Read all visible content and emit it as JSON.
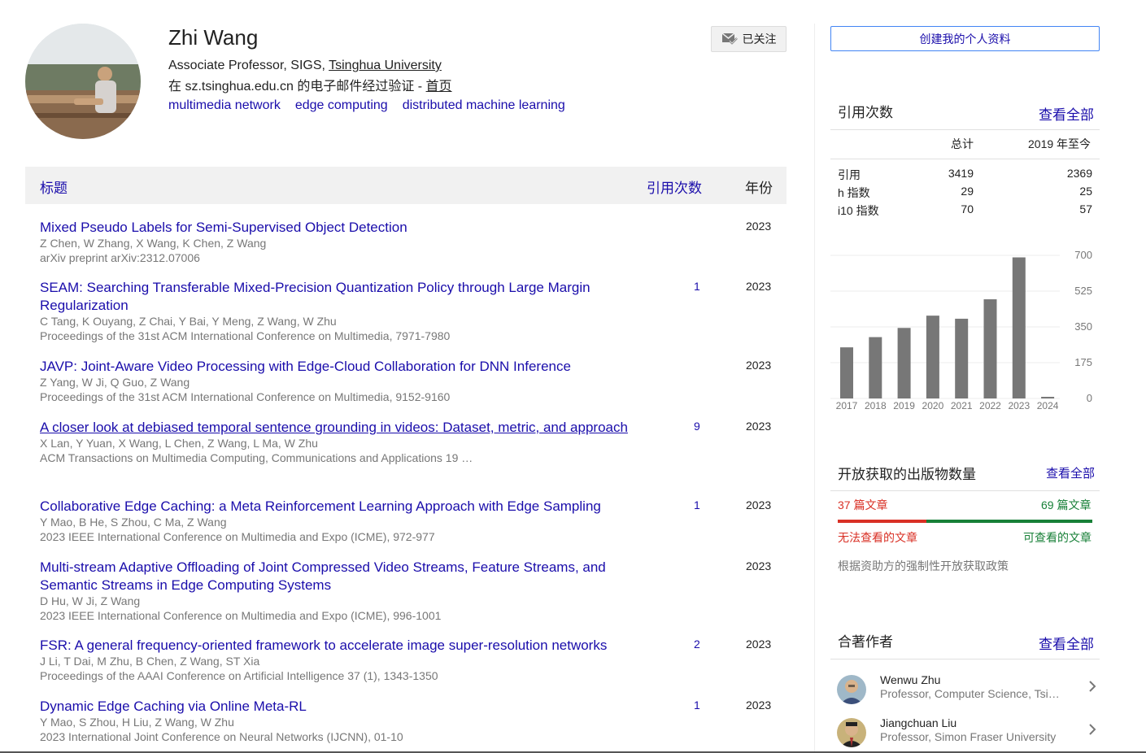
{
  "profile": {
    "name": "Zhi Wang",
    "affiliation_prefix": "Associate Professor, SIGS, ",
    "affiliation_link": "Tsinghua University",
    "verified_text": "在 sz.tsinghua.edu.cn 的电子邮件经过验证 - ",
    "homepage_label": "首页",
    "interests": [
      "multimedia network",
      "edge computing",
      "distributed machine learning"
    ],
    "follow_label": "已关注",
    "follow_icon": "envelope-check-icon"
  },
  "table": {
    "header_title": "标题",
    "header_cites": "引用次数",
    "header_year": "年份"
  },
  "articles": [
    {
      "title": "Mixed Pseudo Labels for Semi-Supervised Object Detection",
      "authors": "Z Chen, W Zhang, X Wang, K Chen, Z Wang",
      "venue": "arXiv preprint arXiv:2312.07006",
      "cites": "",
      "year": "2023"
    },
    {
      "title": "SEAM: Searching Transferable Mixed-Precision Quantization Policy through Large Margin Regularization",
      "authors": "C Tang, K Ouyang, Z Chai, Y Bai, Y Meng, Z Wang, W Zhu",
      "venue": "Proceedings of the 31st ACM International Conference on Multimedia, 7971-7980",
      "cites": "1",
      "year": "2023"
    },
    {
      "title": "JAVP: Joint-Aware Video Processing with Edge-Cloud Collaboration for DNN Inference",
      "authors": "Z Yang, W Ji, Q Guo, Z Wang",
      "venue": "Proceedings of the 31st ACM International Conference on Multimedia, 9152-9160",
      "cites": "",
      "year": "2023"
    },
    {
      "title": "A closer look at debiased temporal sentence grounding in videos: Dataset, metric, and approach",
      "authors": "X Lan, Y Yuan, X Wang, L Chen, Z Wang, L Ma, W Zhu",
      "venue": "ACM Transactions on Multimedia Computing, Communications and Applications 19 …",
      "cites": "9",
      "year": "2023"
    },
    {
      "title": "Collaborative Edge Caching: a Meta Reinforcement Learning Approach with Edge Sampling",
      "authors": "Y Mao, B He, S Zhou, C Ma, Z Wang",
      "venue": "2023 IEEE International Conference on Multimedia and Expo (ICME), 972-977",
      "cites": "1",
      "year": "2023"
    },
    {
      "title": "Multi-stream Adaptive Offloading of Joint Compressed Video Streams, Feature Streams, and Semantic Streams in Edge Computing Systems",
      "authors": "D Hu, W Ji, Z Wang",
      "venue": "2023 IEEE International Conference on Multimedia and Expo (ICME), 996-1001",
      "cites": "",
      "year": "2023"
    },
    {
      "title": "FSR: A general frequency-oriented framework to accelerate image super-resolution networks",
      "authors": "J Li, T Dai, M Zhu, B Chen, Z Wang, ST Xia",
      "venue": "Proceedings of the AAAI Conference on Artificial Intelligence 37 (1), 1343-1350",
      "cites": "2",
      "year": "2023"
    },
    {
      "title": "Dynamic Edge Caching via Online Meta-RL",
      "authors": "Y Mao, S Zhou, H Liu, Z Wang, W Zhu",
      "venue": "2023 International Joint Conference on Neural Networks (IJCNN), 01-10",
      "cites": "1",
      "year": "2023"
    }
  ],
  "sidebar": {
    "create_profile": "创建我的个人资料",
    "citations": {
      "title": "引用次数",
      "view_all": "查看全部",
      "col_total": "总计",
      "col_since": "2019 年至今",
      "rows": [
        {
          "label": "引用",
          "total": "3419",
          "since": "2369"
        },
        {
          "label": "h 指数",
          "total": "29",
          "since": "25"
        },
        {
          "label": "i10 指数",
          "total": "70",
          "since": "57"
        }
      ]
    },
    "open_access": {
      "title": "开放获取的出版物数量",
      "view_all": "查看全部",
      "unavailable_count": "37 篇文章",
      "available_count": "69 篇文章",
      "unavailable_label": "无法查看的文章",
      "available_label": "可查看的文章",
      "policy": "根据资助方的强制性开放获取政策",
      "unavailable_fraction": 0.349,
      "unavailable_color": "#d93025",
      "available_color": "#188038"
    },
    "coauthors": {
      "title": "合著作者",
      "view_all": "查看全部",
      "items": [
        {
          "name": "Wenwu Zhu",
          "affiliation": "Professor, Computer Science, Tsinghua University"
        },
        {
          "name": "Jiangchuan Liu",
          "affiliation": "Professor, Simon Fraser University"
        }
      ]
    }
  },
  "chart_data": {
    "type": "bar",
    "categories": [
      "2017",
      "2018",
      "2019",
      "2020",
      "2021",
      "2022",
      "2023",
      "2024"
    ],
    "values": [
      250,
      300,
      345,
      405,
      390,
      485,
      690,
      8
    ],
    "ylim": [
      0,
      700
    ],
    "yticks": [
      "700",
      "525",
      "350",
      "175",
      "0"
    ],
    "grid": true,
    "bar_color": "#777777"
  }
}
